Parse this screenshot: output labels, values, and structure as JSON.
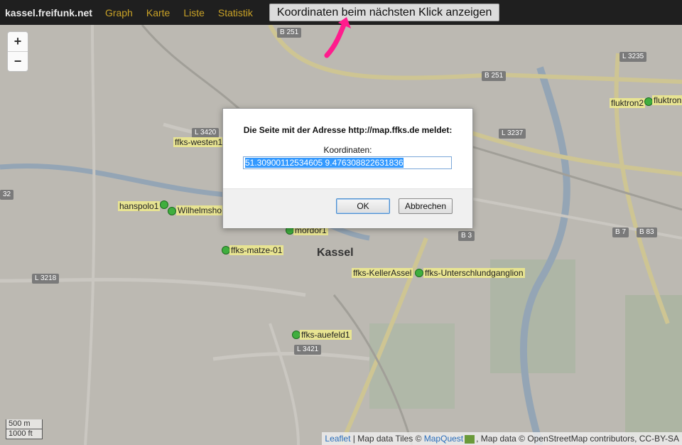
{
  "nav": {
    "brand": "kassel.freifunk.net",
    "links": [
      "Graph",
      "Karte",
      "Liste",
      "Statistik"
    ],
    "coord_button": "Koordinaten beim nächsten Klick anzeigen"
  },
  "zoom": {
    "in": "+",
    "out": "−"
  },
  "map": {
    "city": "Kassel",
    "roads": [
      "B 251",
      "B 251",
      "L 3235",
      "L 3420",
      "L 3237",
      "32",
      "L 3218",
      "B 3",
      "B 7",
      "B 83",
      "L 3421"
    ],
    "nodes": [
      "fluktron2",
      "fluktron",
      "ffks-westen1",
      "hanspolo1",
      "Wilhelmsho",
      "mordor1",
      "ffks-matze-01",
      "ffks-KellerAssel",
      "ffks-Unterschlundganglion",
      "ffks-auefeld1"
    ],
    "scale": {
      "metric": "500 m",
      "imperial": "1000 ft"
    },
    "attribution": {
      "leaflet": "Leaflet",
      "tiles_prefix": " | Map data Tiles © ",
      "mapquest": "MapQuest",
      "osm": ", Map data © OpenStreetMap contributors, CC-BY-SA"
    }
  },
  "dialog": {
    "message": "Die Seite mit der Adresse http://map.ffks.de meldet:",
    "prompt": "Koordinaten:",
    "value": "51.30900112534605 9.476308822631836",
    "ok": "OK",
    "cancel": "Abbrechen"
  },
  "colors": {
    "topbar": "#1f1f1f",
    "nav_link": "#c9a227",
    "node": "#3fae3f",
    "arrow": "#ff1c8d"
  }
}
